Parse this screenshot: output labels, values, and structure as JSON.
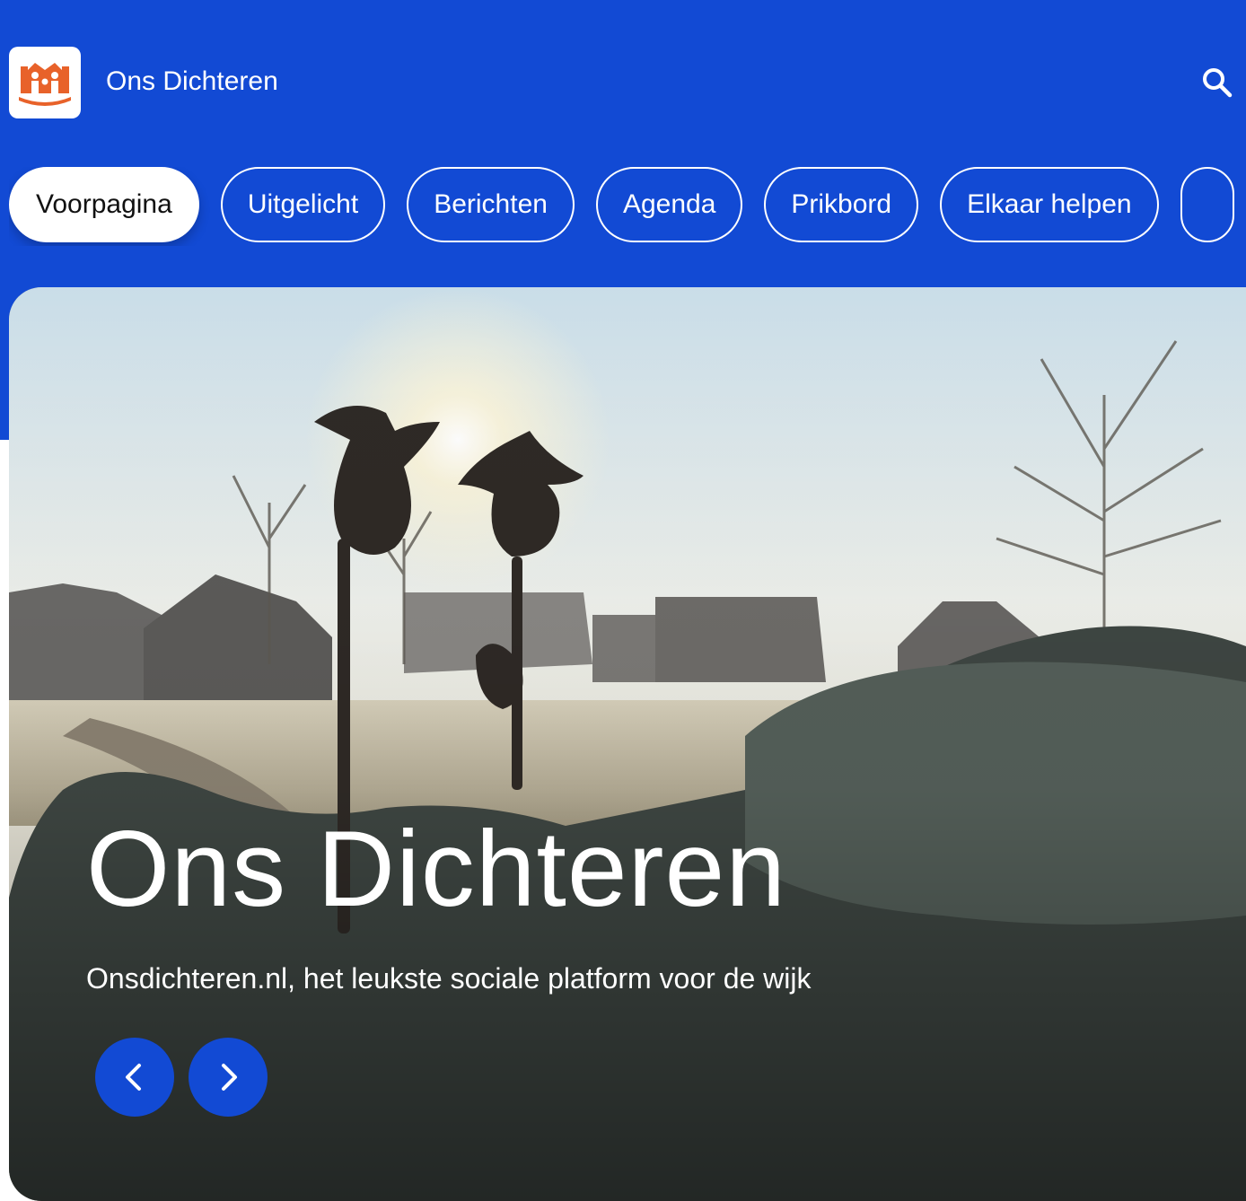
{
  "header": {
    "site_title": "Ons Dichteren",
    "logo_icon": "house-family-logo-icon",
    "search_icon": "search-icon"
  },
  "colors": {
    "brand_blue": "#124ad4",
    "logo_orange": "#e8622a",
    "white": "#ffffff"
  },
  "nav": {
    "tabs": [
      {
        "label": "Voorpagina",
        "active": true
      },
      {
        "label": "Uitgelicht",
        "active": false
      },
      {
        "label": "Berichten",
        "active": false
      },
      {
        "label": "Agenda",
        "active": false
      },
      {
        "label": "Prikbord",
        "active": false
      },
      {
        "label": "Elkaar helpen",
        "active": false
      }
    ]
  },
  "hero": {
    "title": "Ons Dichteren",
    "subtitle": "Onsdichteren.nl, het leukste sociale platform voor de wijk",
    "prev_icon": "chevron-left-icon",
    "next_icon": "chevron-right-icon"
  }
}
